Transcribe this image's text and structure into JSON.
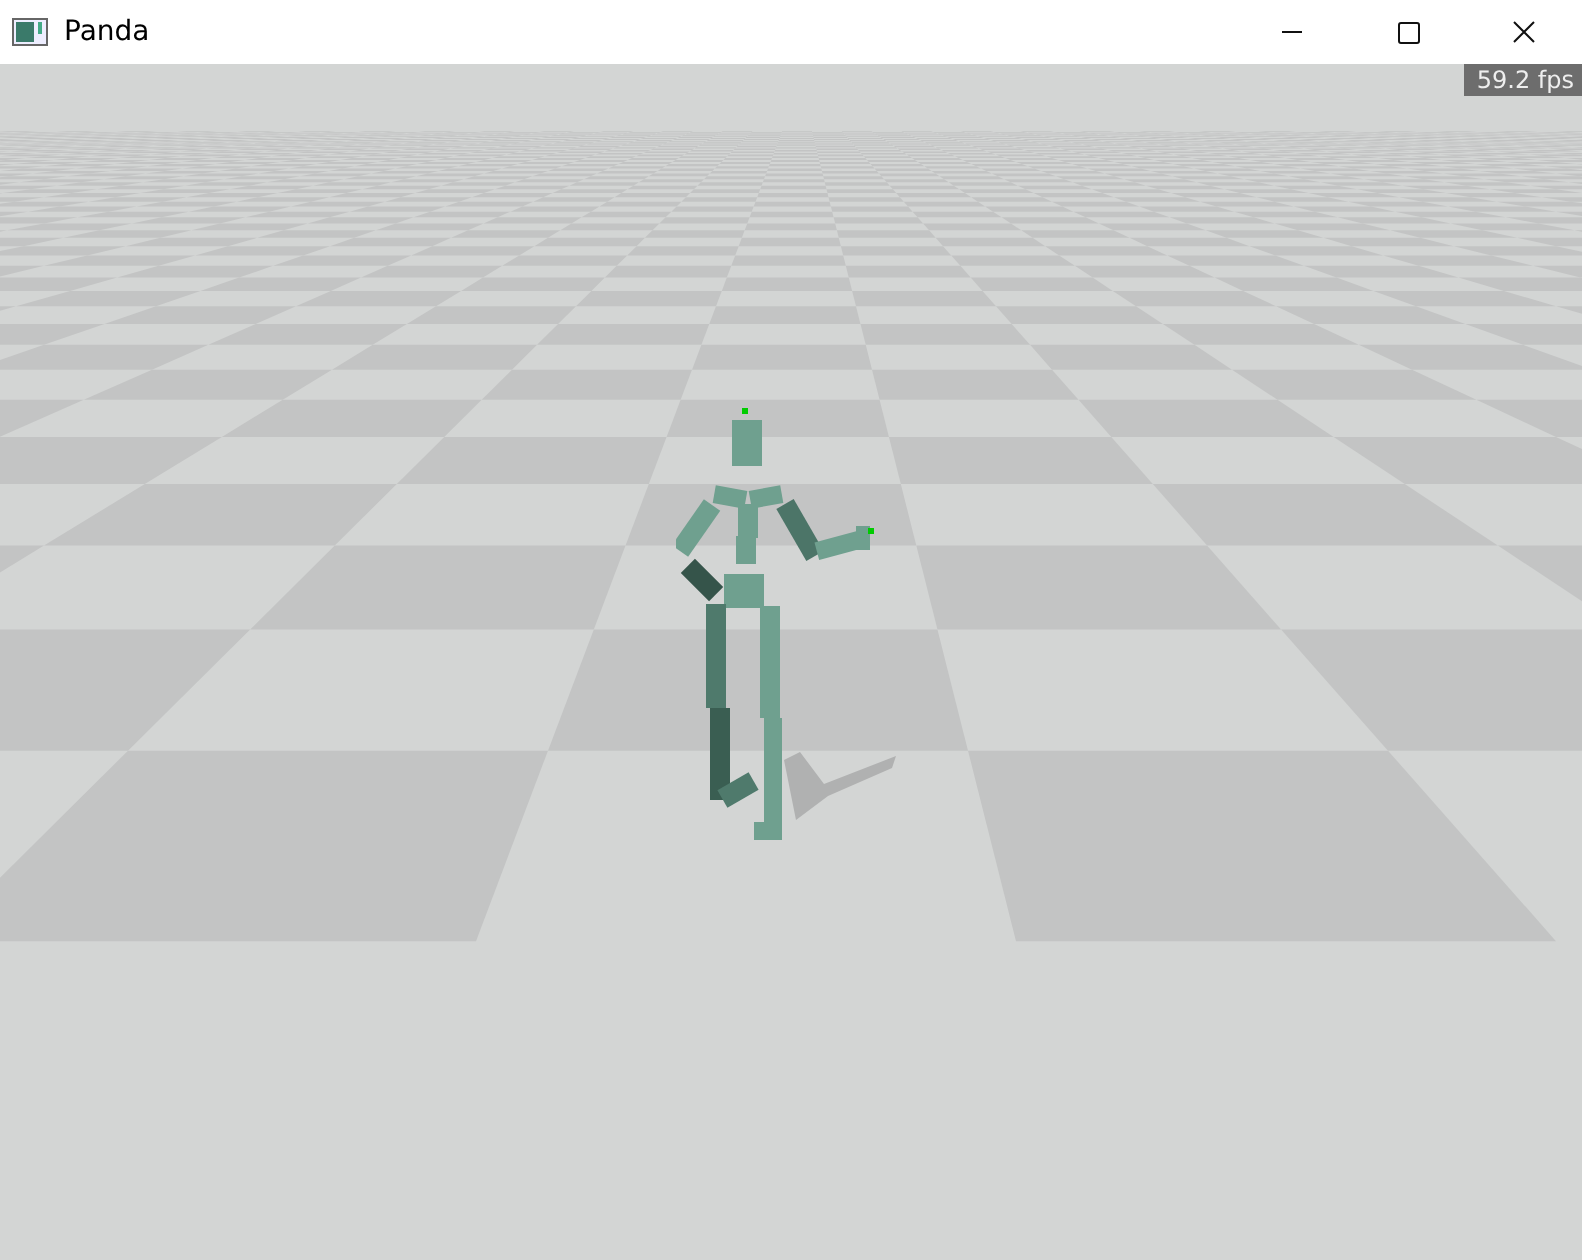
{
  "window": {
    "title": "Panda"
  },
  "viewport": {
    "fps_counter": "59.2 fps"
  }
}
